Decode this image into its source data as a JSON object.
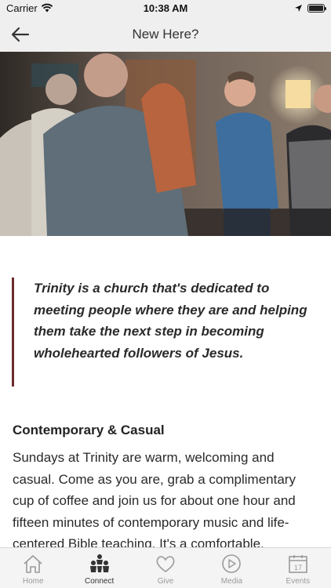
{
  "status": {
    "carrier": "Carrier",
    "time": "10:38 AM",
    "battery": 1.0
  },
  "nav": {
    "title": "New Here?",
    "back_icon": "back-arrow-icon"
  },
  "hero": {
    "icon": "photo-people-gathering"
  },
  "quote": {
    "text": "Trinity is a church that's dedicated to meeting people where they are and helping them take the next step in becoming wholehearted followers of Jesus."
  },
  "section": {
    "title": "Contemporary & Casual",
    "body": "Sundays at Trinity are warm, welcoming and casual. Come as you are, grab a complimentary cup of coffee and join us for about one hour and fifteen minutes of contemporary music and life-centered Bible teaching. It's a comfortable,"
  },
  "tabs": [
    {
      "label": "Home",
      "icon": "home-icon"
    },
    {
      "label": "Connect",
      "icon": "people-icon",
      "active": true
    },
    {
      "label": "Give",
      "icon": "heart-icon"
    },
    {
      "label": "Media",
      "icon": "play-icon"
    },
    {
      "label": "Events",
      "icon": "calendar-icon",
      "calendar_day": "17"
    }
  ],
  "colors": {
    "accent": "#6e2b2b",
    "bar_bg": "#efefef",
    "tab_inactive": "#9a9a9a"
  }
}
